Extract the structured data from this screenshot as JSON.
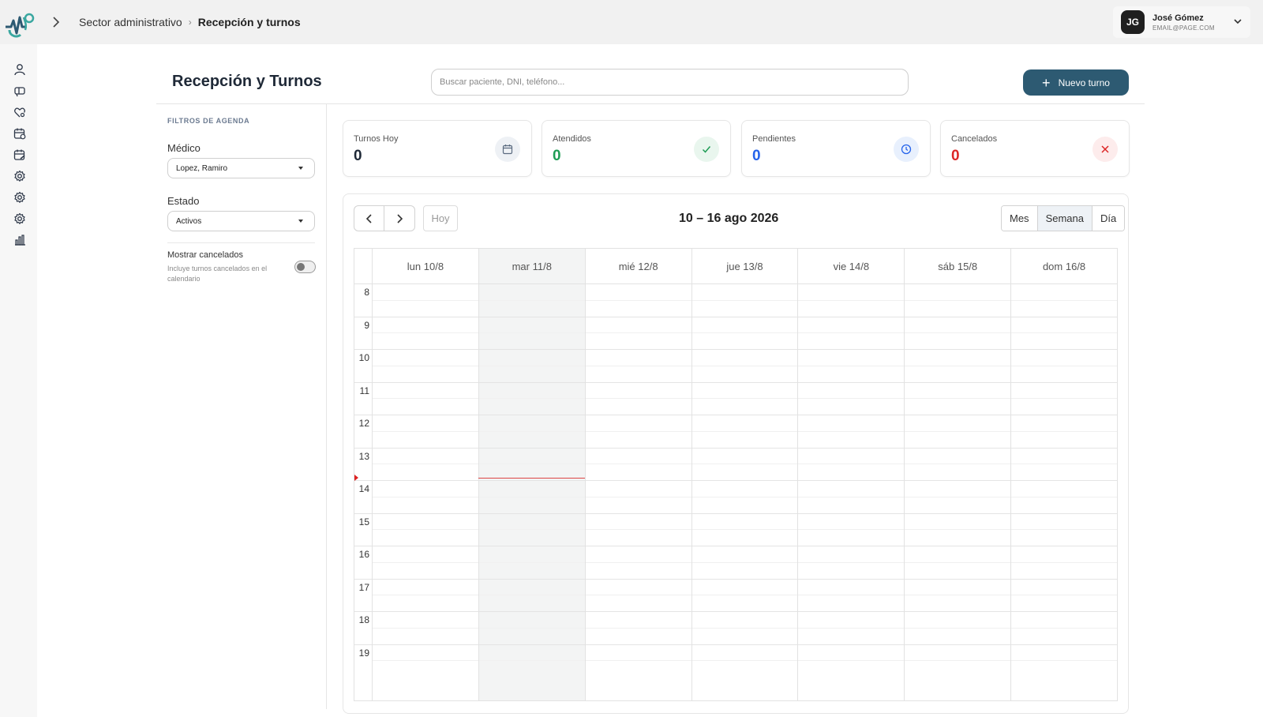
{
  "header": {
    "breadcrumb": [
      "Sector administrativo",
      "Recepción y turnos"
    ],
    "user": {
      "initials": "JG",
      "name": "José Gómez",
      "email": "EMAIL@PAGE.COM"
    }
  },
  "sidebar": {
    "icons": [
      "user-icon",
      "megaphone-icon",
      "heart-search-icon",
      "calendar-clock-icon",
      "calendar-edit-icon",
      "settings-icon",
      "settings-icon",
      "settings-icon",
      "chart-bars-icon"
    ]
  },
  "page": {
    "title": "Recepción y Turnos",
    "search_placeholder": "Buscar paciente, DNI, teléfono...",
    "new_button": "Nuevo turno"
  },
  "filters": {
    "title": "FILTROS DE AGENDA",
    "doctor_label": "Médico",
    "doctor_value": "Lopez, Ramiro",
    "status_label": "Estado",
    "status_value": "Activos",
    "toggle_label": "Mostrar cancelados",
    "toggle_desc": "Incluye turnos cancelados en el calendario",
    "toggle_on": false
  },
  "stats": [
    {
      "label": "Turnos Hoy",
      "value": "0",
      "color": "#1f2937",
      "icon": "calendar-icon",
      "icon_color": "#5b6b80",
      "icon_bg": "#eef1f5"
    },
    {
      "label": "Atendidos",
      "value": "0",
      "color": "#1f9d55",
      "icon": "check-icon",
      "icon_color": "#1f9d55",
      "icon_bg": "#e9f6ee"
    },
    {
      "label": "Pendientes",
      "value": "0",
      "color": "#2563eb",
      "icon": "clock-icon",
      "icon_color": "#2563eb",
      "icon_bg": "#e8f0fd"
    },
    {
      "label": "Cancelados",
      "value": "0",
      "color": "#dc2626",
      "icon": "close-icon",
      "icon_color": "#dc2626",
      "icon_bg": "#fdecec"
    }
  ],
  "calendar": {
    "range_label": "10 – 16 ago 2026",
    "today_label": "Hoy",
    "views": [
      "Mes",
      "Semana",
      "Día"
    ],
    "active_view": "Semana",
    "days": [
      "lun 10/8",
      "mar 11/8",
      "mié 12/8",
      "jue 13/8",
      "vie 14/8",
      "sáb 15/8",
      "dom 16/8"
    ],
    "today_index": 1,
    "hours": [
      "8",
      "9",
      "10",
      "11",
      "12",
      "13",
      "14",
      "15",
      "16",
      "17",
      "18",
      "19"
    ],
    "now_hour": 13.93
  }
}
